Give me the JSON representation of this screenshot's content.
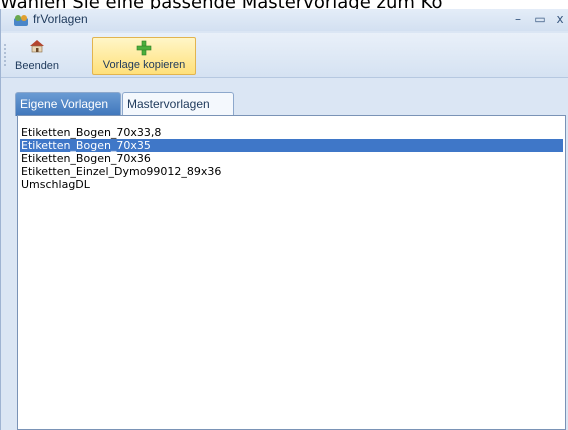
{
  "caption": "Wählen Sie eine passende Mastervorlage zum Ko",
  "window": {
    "title": "frVorlagen",
    "minimize": "–",
    "maximize": "▭",
    "close": "x"
  },
  "toolbar": {
    "exit_label": "Beenden",
    "copy_label": "Vorlage kopieren"
  },
  "tabs": [
    {
      "label": "Eigene Vorlagen",
      "active": false
    },
    {
      "label": "Mastervorlagen",
      "active": true
    }
  ],
  "templates": {
    "selected_index": 1,
    "items": [
      "Etiketten_Bogen_70x33,8",
      "Etiketten_Bogen_70x35",
      "Etiketten_Bogen_70x36",
      "Etiketten_Einzel_Dymo99012_89x36",
      "UmschlagDL"
    ]
  },
  "colors": {
    "selection": "#3f77c8",
    "active_button": "#ffe07a",
    "tab_inactive": "#3f76bb"
  }
}
